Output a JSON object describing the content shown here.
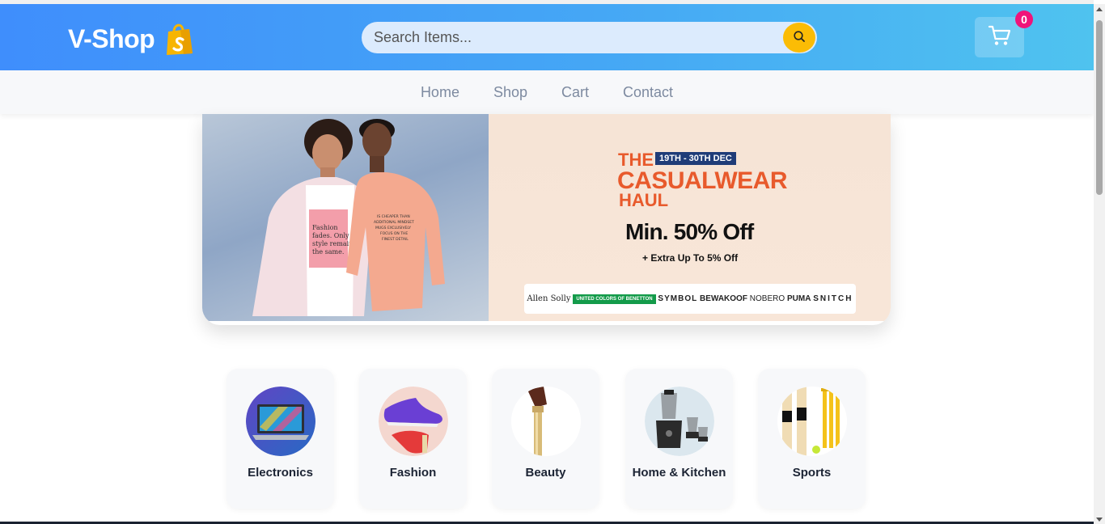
{
  "header": {
    "brand_name": "V-Shop",
    "brand_icon": "shopify-bag-icon",
    "search_placeholder": "Search Items...",
    "search_icon": "search-icon",
    "cart_icon": "cart-icon",
    "cart_count": "0"
  },
  "nav": {
    "items": [
      {
        "label": "Home"
      },
      {
        "label": "Shop"
      },
      {
        "label": "Cart"
      },
      {
        "label": "Contact"
      }
    ]
  },
  "banner": {
    "the": "THE",
    "dates": "19TH - 30TH DEC",
    "title": "CASUALWEAR",
    "subtitle": "HAUL",
    "discount": "Min. 50% Off",
    "extra": "+ Extra Up To 5% Off",
    "shirt_text": "Fashion fades. Only style remains the same.",
    "brands": [
      "Allen Solly",
      "UNITED COLORS OF BENETTON",
      "SYMBOL",
      "BEWAKOOF",
      "NOBERO",
      "PUMA",
      "SNITCH"
    ]
  },
  "categories": [
    {
      "label": "Electronics"
    },
    {
      "label": "Fashion"
    },
    {
      "label": "Beauty"
    },
    {
      "label": "Home & Kitchen"
    },
    {
      "label": "Sports"
    }
  ],
  "colors": {
    "header_start": "#3f8efc",
    "header_end": "#4fc3ef",
    "search_button": "#fbbc05",
    "badge": "#f0137a",
    "promo_orange": "#e85a2c"
  }
}
